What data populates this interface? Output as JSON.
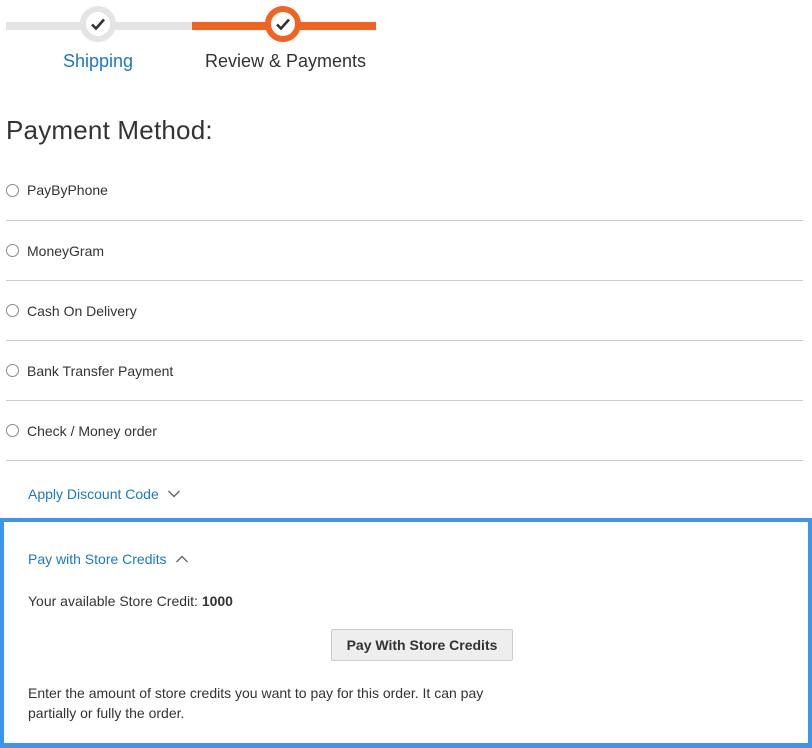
{
  "progress": {
    "steps": [
      {
        "label": "Shipping",
        "state": "complete"
      },
      {
        "label": "Review & Payments",
        "state": "active"
      }
    ],
    "colors": {
      "complete_track": "#e4e4e4",
      "active_track": "#f26322",
      "link": "#1979c3"
    }
  },
  "payment": {
    "title": "Payment Method:",
    "methods": [
      {
        "label": "PayByPhone"
      },
      {
        "label": "MoneyGram"
      },
      {
        "label": "Cash On Delivery"
      },
      {
        "label": "Bank Transfer Payment"
      },
      {
        "label": "Check / Money order"
      }
    ]
  },
  "discount": {
    "label": "Apply Discount Code",
    "icon": "chevron-down-icon"
  },
  "store_credits": {
    "toggle_label": "Pay with Store Credits",
    "toggle_icon": "chevron-up-icon",
    "available_prefix": "Your available Store Credit:",
    "available_amount": "1000",
    "button_label": "Pay With Store Credits",
    "help_text": "Enter the amount of store credits you want to pay for this order. It can pay partially or fully the order.",
    "highlight_color": "#3b95ea"
  }
}
